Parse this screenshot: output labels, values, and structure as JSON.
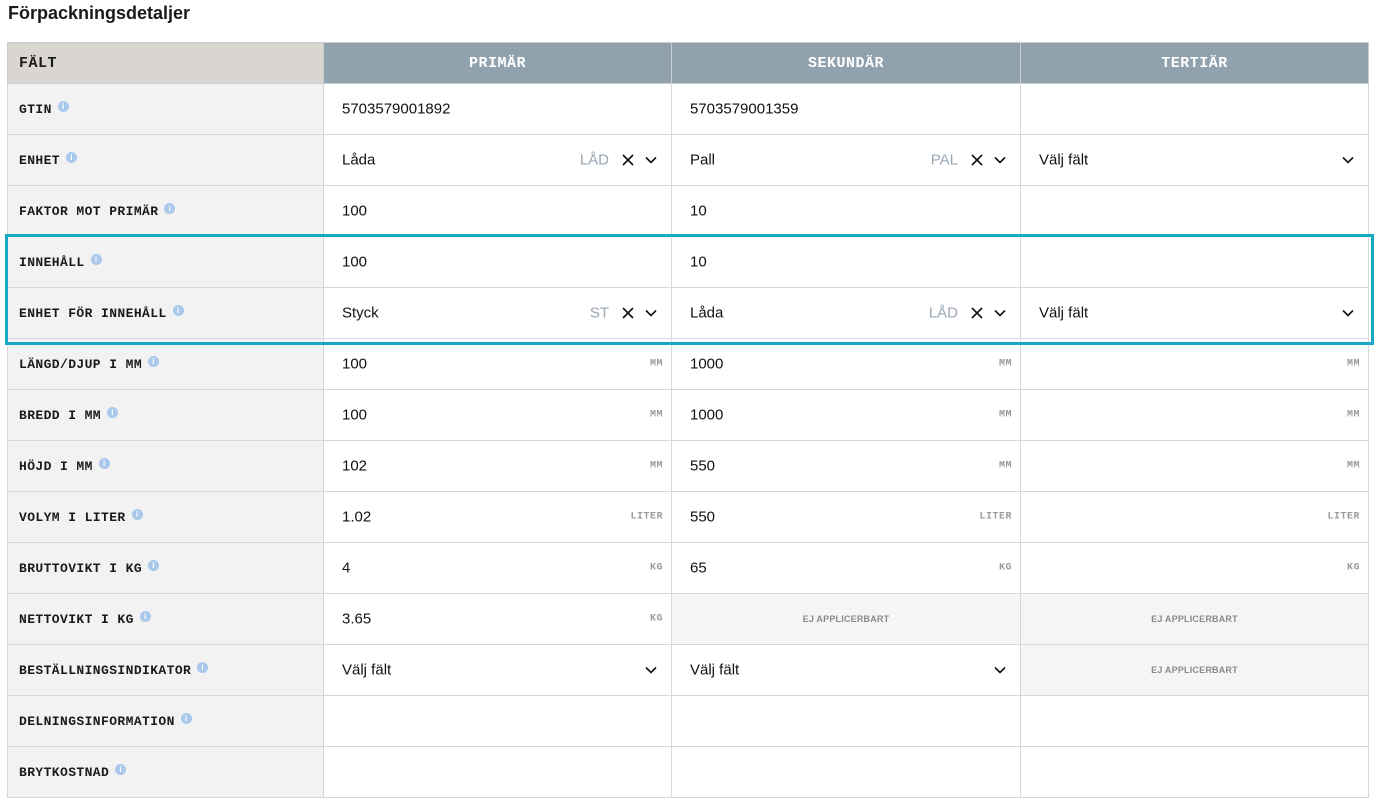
{
  "page": {
    "title": "Förpackningsdetaljer"
  },
  "table": {
    "headers": [
      "FÄLT",
      "PRIMÄR",
      "SEKUNDÄR",
      "TERTIÄR"
    ],
    "rows": [
      {
        "label": "GTIN",
        "primary": {
          "value": "5703579001892"
        },
        "secondary": {
          "value": "5703579001359"
        },
        "tertiary": {
          "value": ""
        }
      },
      {
        "label": "ENHET",
        "primary": {
          "value": "Låda",
          "abbr": "LÅD"
        },
        "secondary": {
          "value": "Pall",
          "abbr": "PAL"
        },
        "tertiary": {
          "value": "Välj fält"
        }
      },
      {
        "label": "FAKTOR MOT PRIMÄR",
        "primary": {
          "value": "100"
        },
        "secondary": {
          "value": "10"
        },
        "tertiary": {
          "value": ""
        }
      },
      {
        "label": "INNEHÅLL",
        "primary": {
          "value": "100"
        },
        "secondary": {
          "value": "10"
        },
        "tertiary": {
          "value": ""
        }
      },
      {
        "label": "ENHET FÖR INNEHÅLL",
        "primary": {
          "value": "Styck",
          "abbr": "ST"
        },
        "secondary": {
          "value": "Låda",
          "abbr": "LÅD"
        },
        "tertiary": {
          "value": "Välj fält"
        }
      },
      {
        "label": "LÄNGD/DJUP I MM",
        "unit": "MM",
        "primary": {
          "value": "100"
        },
        "secondary": {
          "value": "1000"
        },
        "tertiary": {
          "value": ""
        }
      },
      {
        "label": "BREDD I MM",
        "unit": "MM",
        "primary": {
          "value": "100"
        },
        "secondary": {
          "value": "1000"
        },
        "tertiary": {
          "value": ""
        }
      },
      {
        "label": "HÖJD I MM",
        "unit": "MM",
        "primary": {
          "value": "102"
        },
        "secondary": {
          "value": "550"
        },
        "tertiary": {
          "value": ""
        }
      },
      {
        "label": "VOLYM I LITER",
        "unit": "LITER",
        "primary": {
          "value": "1.02"
        },
        "secondary": {
          "value": "550"
        },
        "tertiary": {
          "value": ""
        }
      },
      {
        "label": "BRUTTOVIKT I KG",
        "unit": "KG",
        "primary": {
          "value": "4"
        },
        "secondary": {
          "value": "65"
        },
        "tertiary": {
          "value": ""
        }
      },
      {
        "label": "NETTOVIKT I KG",
        "unit": "KG",
        "primary": {
          "value": "3.65"
        },
        "secondary": {
          "value": "EJ APPLICERBART"
        },
        "tertiary": {
          "value": "EJ APPLICERBART"
        }
      },
      {
        "label": "BESTÄLLNINGSINDIKATOR",
        "primary": {
          "value": "Välj fält"
        },
        "secondary": {
          "value": "Välj fält"
        },
        "tertiary": {
          "value": "EJ APPLICERBART"
        }
      },
      {
        "label": "DELNINGSINFORMATION",
        "primary": {
          "value": ""
        },
        "secondary": {
          "value": ""
        },
        "tertiary": {
          "value": ""
        }
      },
      {
        "label": "BRYTKOSTNAD",
        "primary": {
          "value": ""
        },
        "secondary": {
          "value": ""
        },
        "tertiary": {
          "value": ""
        }
      }
    ]
  },
  "colors": {
    "header_bg": "#8fa2ae",
    "label_bg": "#f2f2f2",
    "highlight": "#19a8c4",
    "info_icon": "#a9c8ec"
  }
}
